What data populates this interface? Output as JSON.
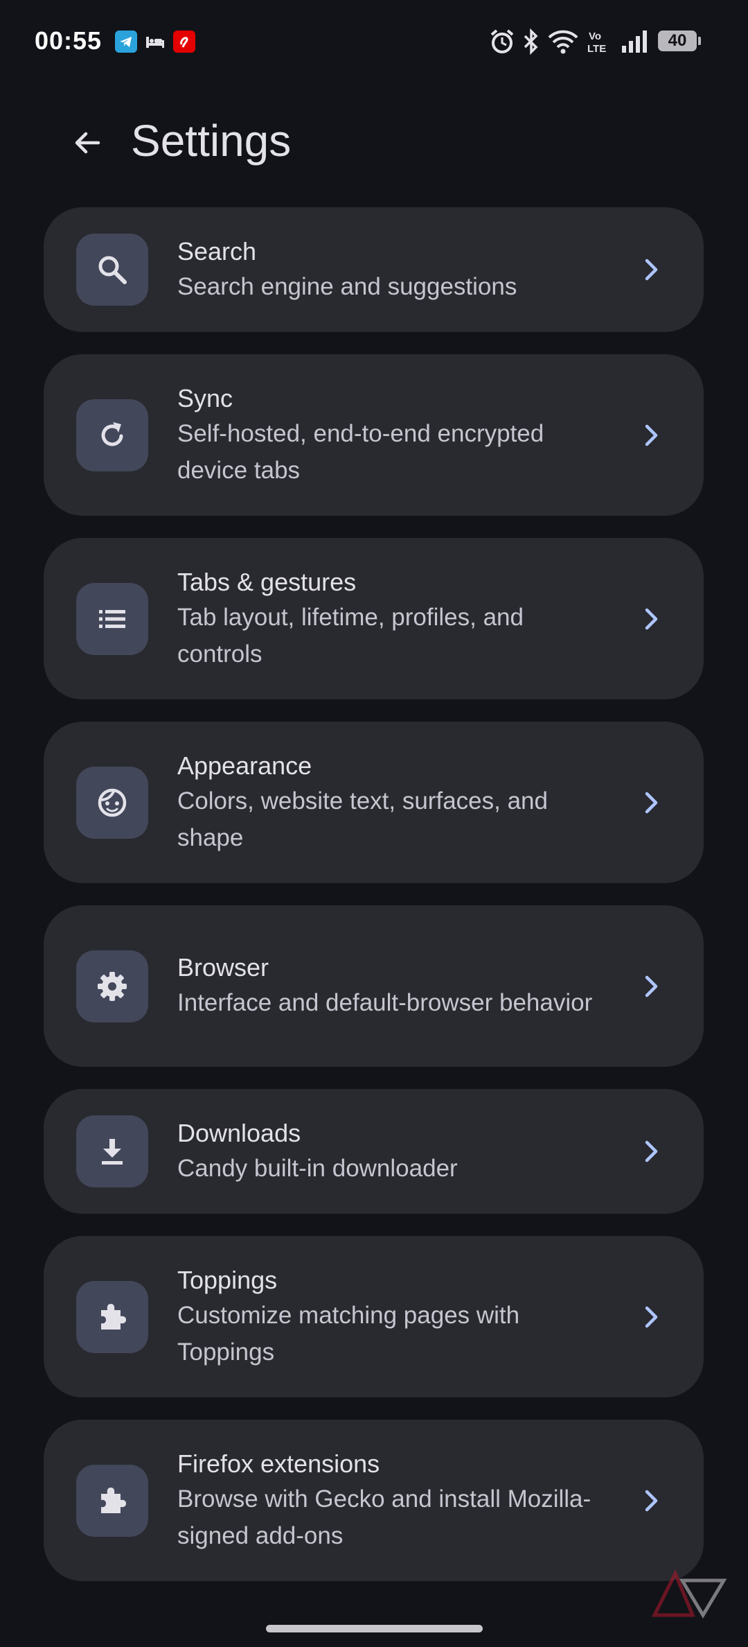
{
  "status_bar": {
    "time": "00:55",
    "battery": "40",
    "icons": [
      "telegram-icon",
      "bed-icon",
      "airtel-icon",
      "alarm-icon",
      "bluetooth-icon",
      "wifi-icon",
      "volte-icon",
      "signal-icon",
      "battery-icon"
    ]
  },
  "header": {
    "title": "Settings",
    "back_icon": "arrow-left-icon"
  },
  "settings": {
    "items": [
      {
        "title": "Search",
        "subtitle": "Search engine and suggestions",
        "icon": "search-icon"
      },
      {
        "title": "Sync",
        "subtitle": "Self-hosted, end-to-end encrypted device tabs",
        "icon": "sync-icon"
      },
      {
        "title": "Tabs & gestures",
        "subtitle": "Tab layout, lifetime, profiles, and controls",
        "icon": "list-icon"
      },
      {
        "title": "Appearance",
        "subtitle": "Colors, website text, surfaces, and shape",
        "icon": "face-icon"
      },
      {
        "title": "Browser",
        "subtitle": "Interface and default-browser behavior",
        "icon": "gear-icon"
      },
      {
        "title": "Downloads",
        "subtitle": "Candy built-in downloader",
        "icon": "download-icon"
      },
      {
        "title": "Toppings",
        "subtitle": "Customize matching pages with Toppings",
        "icon": "puzzle-icon"
      },
      {
        "title": "Firefox extensions",
        "subtitle": "Browse with Gecko and install Mozilla-signed add-ons",
        "icon": "puzzle-icon"
      }
    ]
  },
  "colors": {
    "background": "#121318",
    "card": "#292a2f",
    "icon_box": "#42475a",
    "accent": "#aec6ff",
    "text_primary": "#e3e2e9",
    "text_secondary": "#c5c6d0"
  }
}
